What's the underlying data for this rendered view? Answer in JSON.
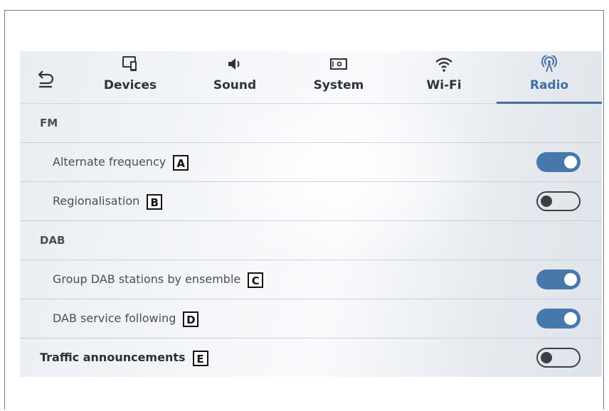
{
  "tabs": [
    {
      "label": "Devices",
      "icon": "phone-screen-icon",
      "active": false
    },
    {
      "label": "Sound",
      "icon": "speaker-icon",
      "active": false
    },
    {
      "label": "System",
      "icon": "system-icon",
      "active": false
    },
    {
      "label": "Wi-Fi",
      "icon": "wifi-icon",
      "active": false
    },
    {
      "label": "Radio",
      "icon": "radio-antenna-icon",
      "active": true
    }
  ],
  "sections": {
    "fm": "FM",
    "dab": "DAB"
  },
  "settings": {
    "alternate_frequency": {
      "label": "Alternate frequency",
      "callout": "A",
      "state": "on"
    },
    "regionalisation": {
      "label": "Regionalisation",
      "callout": "B",
      "state": "off"
    },
    "group_dab": {
      "label": "Group DAB stations by ensemble",
      "callout": "C",
      "state": "on"
    },
    "dab_following": {
      "label": "DAB service following",
      "callout": "D",
      "state": "on"
    },
    "traffic": {
      "label": "Traffic announcements",
      "callout": "E",
      "state": "off"
    }
  },
  "colors": {
    "accent": "#4778ab",
    "active_tab": "#3f6fa3"
  }
}
